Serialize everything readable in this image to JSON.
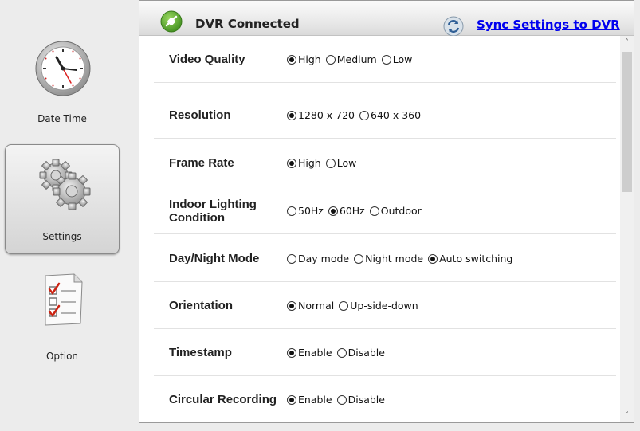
{
  "sidebar": {
    "items": [
      {
        "label": "Date Time",
        "icon": "clock-icon"
      },
      {
        "label": "Settings",
        "icon": "gears-icon",
        "active": true
      },
      {
        "label": "Option",
        "icon": "checklist-icon"
      }
    ]
  },
  "header": {
    "status": "DVR Connected",
    "status_icon": "connected-icon",
    "sync_label": "Sync Settings to DVR",
    "sync_icon": "sync-icon",
    "status_color": "#5aa82a",
    "link_color": "#0000ee"
  },
  "settings": [
    {
      "label": "Video Quality",
      "options": [
        {
          "label": "High",
          "checked": true
        },
        {
          "label": "Medium",
          "checked": false
        },
        {
          "label": "Low",
          "checked": false
        }
      ]
    },
    {
      "label": "Resolution",
      "options": [
        {
          "label": "1280 x 720",
          "checked": true
        },
        {
          "label": "640 x 360",
          "checked": false
        }
      ]
    },
    {
      "label": "Frame Rate",
      "options": [
        {
          "label": "High",
          "checked": true
        },
        {
          "label": "Low",
          "checked": false
        }
      ]
    },
    {
      "label": "Indoor Lighting Condition",
      "options": [
        {
          "label": "50Hz",
          "checked": false
        },
        {
          "label": "60Hz",
          "checked": true
        },
        {
          "label": "Outdoor",
          "checked": false
        }
      ]
    },
    {
      "label": "Day/Night Mode",
      "options": [
        {
          "label": "Day mode",
          "checked": false
        },
        {
          "label": "Night mode",
          "checked": false
        },
        {
          "label": "Auto switching",
          "checked": true
        }
      ]
    },
    {
      "label": "Orientation",
      "options": [
        {
          "label": "Normal",
          "checked": true
        },
        {
          "label": "Up-side-down",
          "checked": false
        }
      ]
    },
    {
      "label": "Timestamp",
      "options": [
        {
          "label": "Enable",
          "checked": true
        },
        {
          "label": "Disable",
          "checked": false
        }
      ]
    },
    {
      "label": "Circular Recording",
      "options": [
        {
          "label": "Enable",
          "checked": true
        },
        {
          "label": "Disable",
          "checked": false
        }
      ]
    }
  ],
  "scrollbar": {
    "up_icon": "chevron-up-icon",
    "down_icon": "chevron-down-icon"
  }
}
